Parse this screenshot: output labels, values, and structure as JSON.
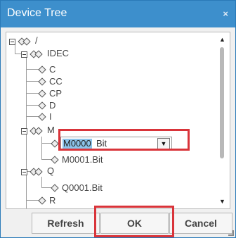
{
  "dialog": {
    "title": "Device Tree",
    "close_symbol": "×"
  },
  "tree": {
    "root": "/",
    "device": "IDEC",
    "nodes": {
      "c": "C",
      "cc": "CC",
      "cp": "CP",
      "d": "D",
      "i": "I",
      "m": "M",
      "m0001": "M0001.Bit",
      "q": "Q",
      "q0001": "Q0001.Bit",
      "r": "R"
    },
    "editor": {
      "selected_text": "M0000",
      "type_value": "Bit",
      "dropdown_symbol": "▼"
    }
  },
  "scrollbar": {
    "up_symbol": "▲",
    "down_symbol": "▼"
  },
  "buttons": {
    "refresh": "Refresh",
    "ok": "OK",
    "cancel": "Cancel"
  },
  "colors": {
    "titlebar": "#3d8fcc",
    "highlight_box": "#d9343a",
    "selection": "#8cc4ea"
  },
  "icons": {
    "expander": "expander-minus-icon",
    "node_pair": "device-node-icon",
    "leaf": "diamond-leaf-icon",
    "close": "close-icon"
  }
}
